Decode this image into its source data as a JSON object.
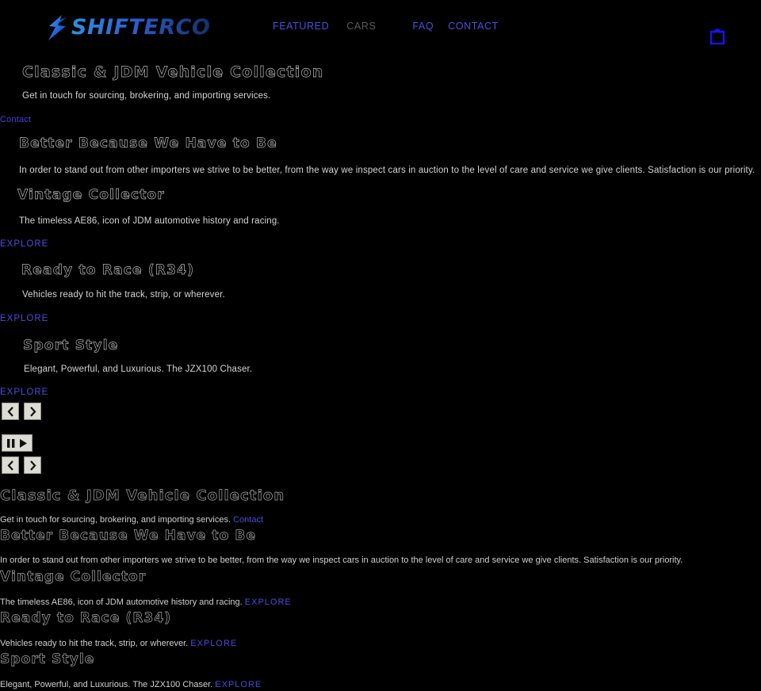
{
  "header": {
    "logo_text": "SHIFTERCO",
    "logo_icon": "lightning-bolt-icon",
    "nav": [
      {
        "label": "FEATURED",
        "color": "#4e4edb"
      },
      {
        "label": "CARS",
        "color": "#5a5a5a"
      },
      {
        "label": "FAQ",
        "color": "#4e4edb"
      },
      {
        "label": "CONTACT",
        "color": "#4e4edb"
      }
    ],
    "cart_icon": "shopping-bag-icon",
    "cart_color": "#1414ff"
  },
  "slides": {
    "contact": {
      "title": "Classic & JDM Vehicle Collection",
      "subtitle": "Get in touch for sourcing, brokering, and importing services.",
      "link": "Contact"
    },
    "better": {
      "title": "Better Because We Have to Be",
      "subtitle": "In order to stand out from other importers we strive to be better, from the way we inspect cars in auction to the level of care and service we give clients. Satisfaction is our priority."
    },
    "vintage": {
      "title": "Vintage Collector",
      "subtitle": "The timeless AE86, icon of JDM automotive history and racing.",
      "link": "EXPLORE"
    },
    "race": {
      "title": "Ready to Race (R34)",
      "subtitle": "Vehicles ready to hit the track, strip, or wherever.",
      "link": "EXPLORE"
    },
    "sport": {
      "title": "Sport Style",
      "subtitle": "Elegant, Powerful, and Luxurious. The JZX100 Chaser.",
      "link": "EXPLORE"
    }
  },
  "carousel_controls": {
    "previous_label": "‹",
    "next_label": "›",
    "pause_label": "‖",
    "play_label": "▶"
  },
  "colors": {
    "background": "#000000",
    "link_blue": "#4b4bdd",
    "body_text": "#d6d6d6",
    "heading_stroke": "#b9b9b9",
    "logo_blue": "#2f8fe0"
  }
}
